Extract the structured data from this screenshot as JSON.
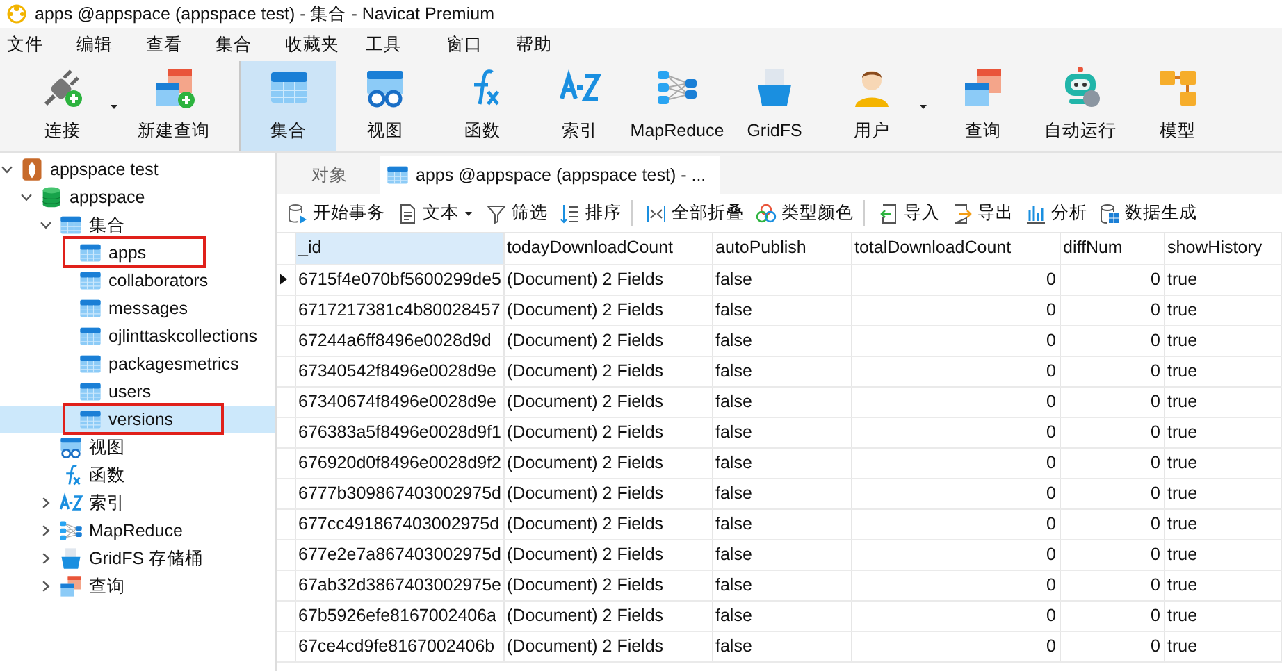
{
  "window": {
    "title": "apps @appspace (appspace test) - 集合 - Navicat Premium"
  },
  "menu": [
    "文件",
    "编辑",
    "查看",
    "集合",
    "收藏夹",
    "工具",
    "窗口",
    "帮助"
  ],
  "toolbar": [
    {
      "label": "连接",
      "kind": "connect",
      "dropdown": true,
      "selected": false
    },
    {
      "label": "新建查询",
      "kind": "newquery",
      "dropdown": false,
      "selected": false
    },
    {
      "label": "集合",
      "kind": "collection",
      "dropdown": false,
      "selected": true,
      "group_start": true
    },
    {
      "label": "视图",
      "kind": "view",
      "dropdown": false,
      "selected": false
    },
    {
      "label": "函数",
      "kind": "function",
      "dropdown": false,
      "selected": false
    },
    {
      "label": "索引",
      "kind": "index",
      "dropdown": false,
      "selected": false
    },
    {
      "label": "MapReduce",
      "kind": "mapreduce",
      "dropdown": false,
      "selected": false
    },
    {
      "label": "GridFS",
      "kind": "gridfs",
      "dropdown": false,
      "selected": false
    },
    {
      "label": "用户",
      "kind": "user",
      "dropdown": true,
      "selected": false
    },
    {
      "label": "查询",
      "kind": "query",
      "dropdown": false,
      "selected": false
    },
    {
      "label": "自动运行",
      "kind": "robot",
      "dropdown": false,
      "selected": false
    },
    {
      "label": "模型",
      "kind": "model",
      "dropdown": false,
      "selected": false
    }
  ],
  "sidebar": {
    "tree": [
      {
        "label": "appspace test",
        "kind": "connection",
        "expanded": true,
        "children": [
          {
            "label": "appspace",
            "kind": "database",
            "expanded": true,
            "children": [
              {
                "label": "集合",
                "kind": "collection",
                "expanded": true,
                "children": [
                  {
                    "label": "apps",
                    "kind": "collection",
                    "selected": false,
                    "highlighted": true
                  },
                  {
                    "label": "collaborators",
                    "kind": "collection",
                    "selected": false,
                    "highlighted": false
                  },
                  {
                    "label": "messages",
                    "kind": "collection",
                    "selected": false,
                    "highlighted": false
                  },
                  {
                    "label": "ojlinttaskcollections",
                    "kind": "collection",
                    "selected": false,
                    "highlighted": false
                  },
                  {
                    "label": "packagesmetrics",
                    "kind": "collection",
                    "selected": false,
                    "highlighted": false
                  },
                  {
                    "label": "users",
                    "kind": "collection",
                    "selected": false,
                    "highlighted": false
                  },
                  {
                    "label": "versions",
                    "kind": "collection",
                    "selected": true,
                    "highlighted": true
                  }
                ]
              },
              {
                "label": "视图",
                "kind": "view"
              },
              {
                "label": "函数",
                "kind": "function"
              },
              {
                "label": "索引",
                "kind": "index",
                "expanded": false
              },
              {
                "label": "MapReduce",
                "kind": "mapreduce",
                "expanded": false
              },
              {
                "label": "GridFS 存储桶",
                "kind": "gridfs",
                "expanded": false
              },
              {
                "label": "查询",
                "kind": "query",
                "expanded": false
              }
            ]
          }
        ]
      }
    ]
  },
  "tabs": [
    {
      "label": "对象",
      "kind": "plain",
      "selected": false
    },
    {
      "label": "apps @appspace (appspace test) - ...",
      "kind": "collection",
      "selected": true
    }
  ],
  "actions": [
    {
      "label": "开始事务",
      "kind": "transaction"
    },
    {
      "label": "文本",
      "kind": "text",
      "dropdown": true
    },
    {
      "label": "筛选",
      "kind": "filter"
    },
    {
      "label": "排序",
      "kind": "sort",
      "separator_after": true
    },
    {
      "label": "全部折叠",
      "kind": "collapse"
    },
    {
      "label": "类型颜色",
      "kind": "colors",
      "separator_after": true
    },
    {
      "label": "导入",
      "kind": "import"
    },
    {
      "label": "导出",
      "kind": "export"
    },
    {
      "label": "分析",
      "kind": "analyze"
    },
    {
      "label": "数据生成",
      "kind": "generate"
    }
  ],
  "table": {
    "columns": [
      "_id",
      "todayDownloadCount",
      "autoPublish",
      "totalDownloadCount",
      "diffNum",
      "showHistory"
    ],
    "rows": [
      {
        "cells": [
          "6715f4e070bf5600299de5",
          "(Document) 2 Fields",
          "false",
          "0",
          "0",
          "true"
        ],
        "selected": true
      },
      {
        "cells": [
          "6717217381c4b80028457",
          "(Document) 2 Fields",
          "false",
          "0",
          "0",
          "true"
        ],
        "selected": false
      },
      {
        "cells": [
          "67244a6ff8496e0028d9d",
          "(Document) 2 Fields",
          "false",
          "0",
          "0",
          "true"
        ],
        "selected": false
      },
      {
        "cells": [
          "67340542f8496e0028d9e",
          "(Document) 2 Fields",
          "false",
          "0",
          "0",
          "true"
        ],
        "selected": false
      },
      {
        "cells": [
          "67340674f8496e0028d9e",
          "(Document) 2 Fields",
          "false",
          "0",
          "0",
          "true"
        ],
        "selected": false
      },
      {
        "cells": [
          "676383a5f8496e0028d9f1",
          "(Document) 2 Fields",
          "false",
          "0",
          "0",
          "true"
        ],
        "selected": false
      },
      {
        "cells": [
          "676920d0f8496e0028d9f2",
          "(Document) 2 Fields",
          "false",
          "0",
          "0",
          "true"
        ],
        "selected": false
      },
      {
        "cells": [
          "6777b309867403002975d",
          "(Document) 2 Fields",
          "false",
          "0",
          "0",
          "true"
        ],
        "selected": false
      },
      {
        "cells": [
          "677cc491867403002975d",
          "(Document) 2 Fields",
          "false",
          "0",
          "0",
          "true"
        ],
        "selected": false
      },
      {
        "cells": [
          "677e2e7a867403002975d",
          "(Document) 2 Fields",
          "false",
          "0",
          "0",
          "true"
        ],
        "selected": false
      },
      {
        "cells": [
          "67ab32d3867403002975e",
          "(Document) 2 Fields",
          "false",
          "0",
          "0",
          "true"
        ],
        "selected": false
      },
      {
        "cells": [
          "67b5926efe8167002406a",
          "(Document) 2 Fields",
          "false",
          "0",
          "0",
          "true"
        ],
        "selected": false
      },
      {
        "cells": [
          "67ce4cd9fe8167002406b",
          "(Document) 2 Fields",
          "false",
          "0",
          "0",
          "true"
        ],
        "selected": false
      }
    ]
  }
}
